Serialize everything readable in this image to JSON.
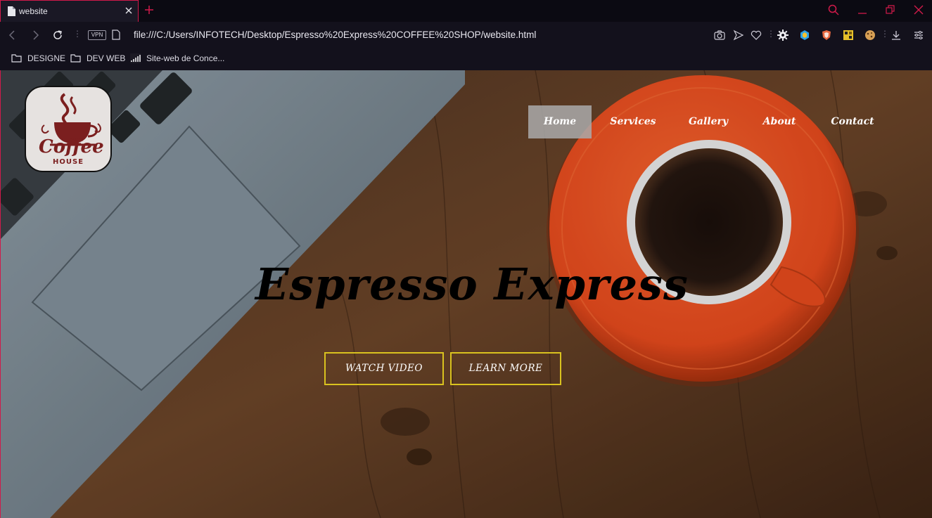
{
  "browser": {
    "tab_title": "website",
    "url": "file:///C:/Users/INFOTECH/Desktop/Espresso%20Express%20COFFEE%20SHOP/website.html",
    "vpn_label": "VPN",
    "bookmarks": [
      {
        "label": "DESIGNE",
        "icon": "folder-icon"
      },
      {
        "label": "DEV WEB",
        "icon": "folder-icon"
      },
      {
        "label": "Site-web de Conce...",
        "icon": "signal-icon"
      }
    ],
    "accent_color": "#d11a4a"
  },
  "site": {
    "logo": {
      "word": "Coffee",
      "sub": "HOUSE"
    },
    "nav": [
      {
        "label": "Home",
        "active": true
      },
      {
        "label": "Services",
        "active": false
      },
      {
        "label": "Gallery",
        "active": false
      },
      {
        "label": "About",
        "active": false
      },
      {
        "label": "Contact",
        "active": false
      }
    ],
    "headline": "Espresso Express",
    "buttons": {
      "watch": "WATCH VIDEO",
      "learn": "LEARN MORE"
    },
    "button_border_color": "#d9c21f"
  }
}
